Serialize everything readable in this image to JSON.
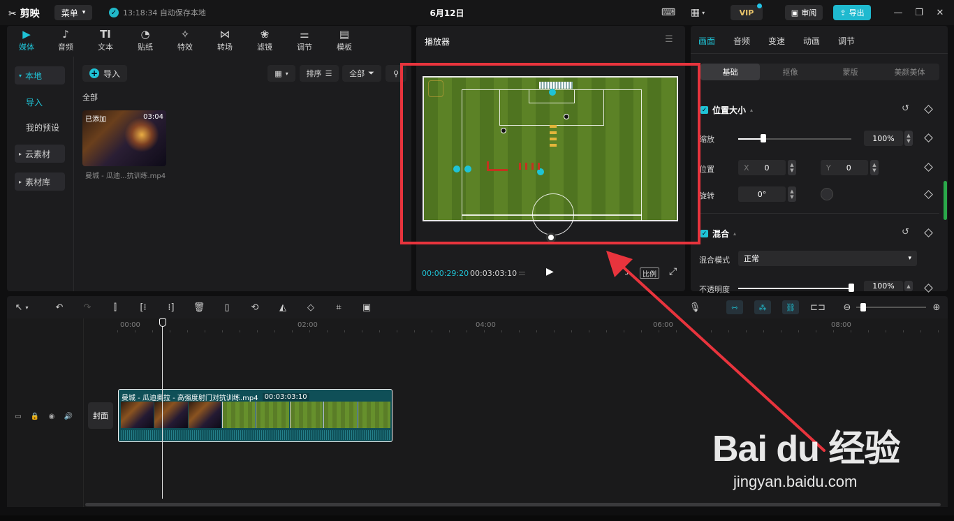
{
  "titlebar": {
    "app_name": "剪映",
    "menu_label": "菜单",
    "save_status": "13:18:34 自动保存本地",
    "project_title": "6月12日",
    "vip_label": "VIP",
    "review_label": "审阅",
    "export_label": "导出"
  },
  "media": {
    "tools": [
      {
        "label": "媒体",
        "icon": "media-icon"
      },
      {
        "label": "音频",
        "icon": "audio-icon"
      },
      {
        "label": "文本",
        "icon": "text-icon"
      },
      {
        "label": "贴纸",
        "icon": "sticker-icon"
      },
      {
        "label": "特效",
        "icon": "effects-icon"
      },
      {
        "label": "转场",
        "icon": "transition-icon"
      },
      {
        "label": "滤镜",
        "icon": "filter-icon"
      },
      {
        "label": "调节",
        "icon": "adjust-icon"
      },
      {
        "label": "模板",
        "icon": "template-icon"
      }
    ],
    "text_tool_glyph": "TI",
    "nav": {
      "local": "本地",
      "import": "导入",
      "presets": "我的预设",
      "cloud": "云素材",
      "library": "素材库"
    },
    "import_button": "导入",
    "sort_label": "排序",
    "filter_label": "全部",
    "section_label": "全部",
    "item": {
      "badge": "已添加",
      "duration": "03:04",
      "name": "曼城 - 瓜迪...抗训练.mp4"
    }
  },
  "player": {
    "title": "播放器",
    "time_current": "00:00:29:20",
    "time_total": "00:03:03:10",
    "ratio_label": "比例"
  },
  "props": {
    "tabs": [
      "画面",
      "音频",
      "变速",
      "动画",
      "调节"
    ],
    "subtabs": [
      "基础",
      "抠像",
      "蒙版",
      "美颜美体"
    ],
    "position_size_title": "位置大小",
    "scale_label": "缩放",
    "scale_value": "100%",
    "scale_fraction": 0.22,
    "position_label": "位置",
    "pos_x_label": "X",
    "pos_x_value": "0",
    "pos_y_label": "Y",
    "pos_y_value": "0",
    "rotate_label": "旋转",
    "rotate_value": "0°",
    "blend_title": "混合",
    "blend_mode_label": "混合模式",
    "blend_mode_value": "正常",
    "opacity_label": "不透明度",
    "opacity_value": "100%",
    "opacity_fraction": 1.0
  },
  "timeline": {
    "ruler_labels": [
      "00:00",
      "02:00",
      "04:00",
      "06:00",
      "08:00"
    ],
    "cover_label": "封面",
    "clip_name": "曼城 - 瓜迪奥拉 - 高强度射门对抗训练.mp4",
    "clip_duration": "00:03:03:10"
  },
  "watermark": {
    "logo_text": "Bai du 经验",
    "url": "jingyan.baidu.com"
  },
  "colors": {
    "accent": "#1fc3d6",
    "highlight": "#e8343d"
  }
}
